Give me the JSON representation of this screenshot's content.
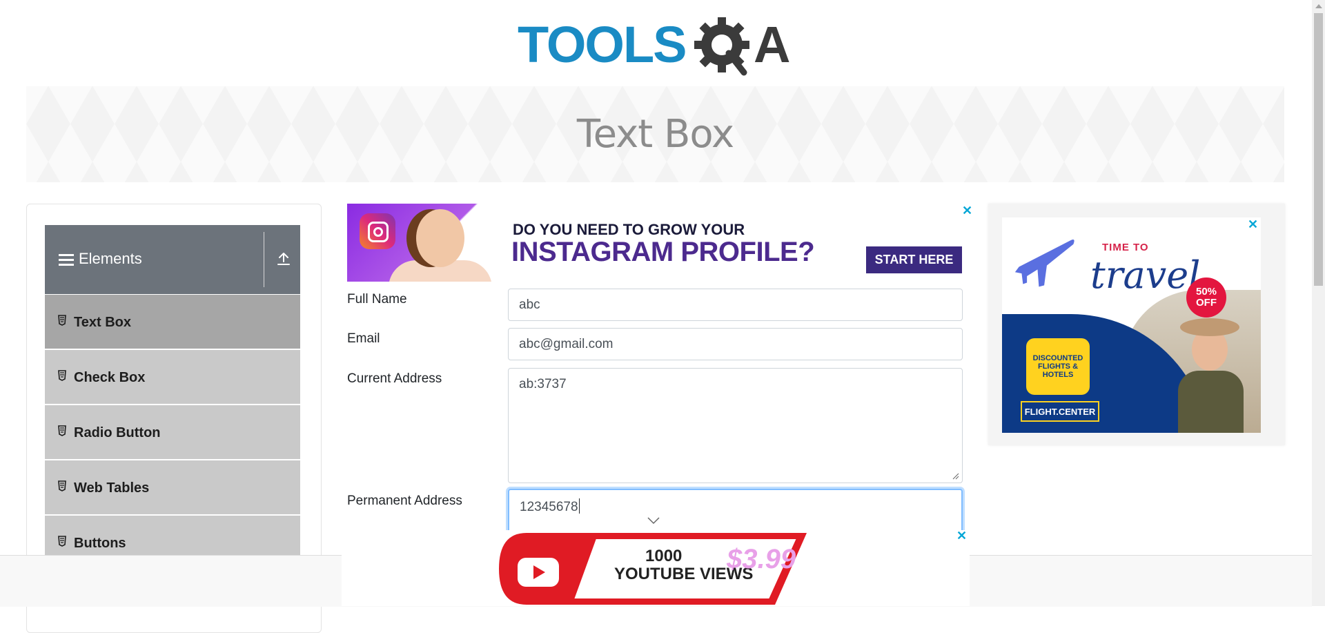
{
  "header": {
    "logo_text_left": "TOOLS",
    "logo_text_right": "A",
    "logo_text_left_color": "#1a8bc4",
    "logo_text_right_color": "#3b3b3b"
  },
  "banner": {
    "title": "Text Box"
  },
  "sidebar": {
    "group_title": "Elements",
    "group_icon": "hamburger-icon",
    "toggle_icon": "collapse-up-icon",
    "items": [
      {
        "label": "Text Box",
        "icon": "document-icon",
        "active": true
      },
      {
        "label": "Check Box",
        "icon": "document-icon",
        "active": false
      },
      {
        "label": "Radio Button",
        "icon": "document-icon",
        "active": false
      },
      {
        "label": "Web Tables",
        "icon": "document-icon",
        "active": false
      },
      {
        "label": "Buttons",
        "icon": "document-icon",
        "active": false
      }
    ]
  },
  "form": {
    "full_name_label": "Full Name",
    "full_name_value": "abc",
    "email_label": "Email",
    "email_value": "abc@gmail.com",
    "current_address_label": "Current Address",
    "current_address_value": "ab:3737",
    "permanent_address_label": "Permanent Address",
    "permanent_address_value": "12345678"
  },
  "ads": {
    "top": {
      "line1": "DO YOU NEED TO GROW YOUR",
      "line2": "INSTAGRAM PROFILE?",
      "cta": "START HERE",
      "close": "✕"
    },
    "side": {
      "line1": "TIME TO",
      "line2": "travel",
      "badge_pct": "50%",
      "badge_off": "OFF",
      "bubble": "DISCOUNTED FLIGHTS & HOTELS",
      "brand": "FLIGHT.CENTER",
      "close": "✕"
    },
    "bottom": {
      "line1": "1000",
      "line2": "YOUTUBE VIEWS",
      "price": "$3.99",
      "close": "✕"
    }
  },
  "colors": {
    "sidebar_header": "#6c737b",
    "sidebar_item": "#c9c9c9",
    "sidebar_item_active": "#a6a6a6",
    "focus_border": "#80bdff",
    "ad_close": "#00a6d6"
  }
}
